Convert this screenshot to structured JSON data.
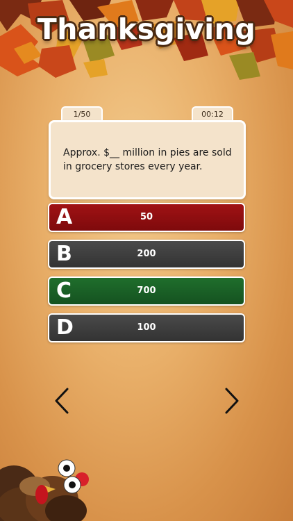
{
  "header": {
    "title": "Thanksgiving"
  },
  "quiz": {
    "progress": "1/50",
    "timer": "00:12",
    "question": "Approx. $__ million in pies are sold in grocery stores every year."
  },
  "answers": [
    {
      "letter": "A",
      "value": "50",
      "color": "#8e0e10"
    },
    {
      "letter": "B",
      "value": "200",
      "color": "#3c3c3c"
    },
    {
      "letter": "C",
      "value": "700",
      "color": "#1a5f26"
    },
    {
      "letter": "D",
      "value": "100",
      "color": "#3c3c3c"
    }
  ],
  "navigation": {
    "prev_icon": "chevron-left-icon",
    "next_icon": "chevron-right-icon"
  },
  "decor": {
    "header_decor": "autumn-leaves",
    "corner_decor": "turkey"
  }
}
